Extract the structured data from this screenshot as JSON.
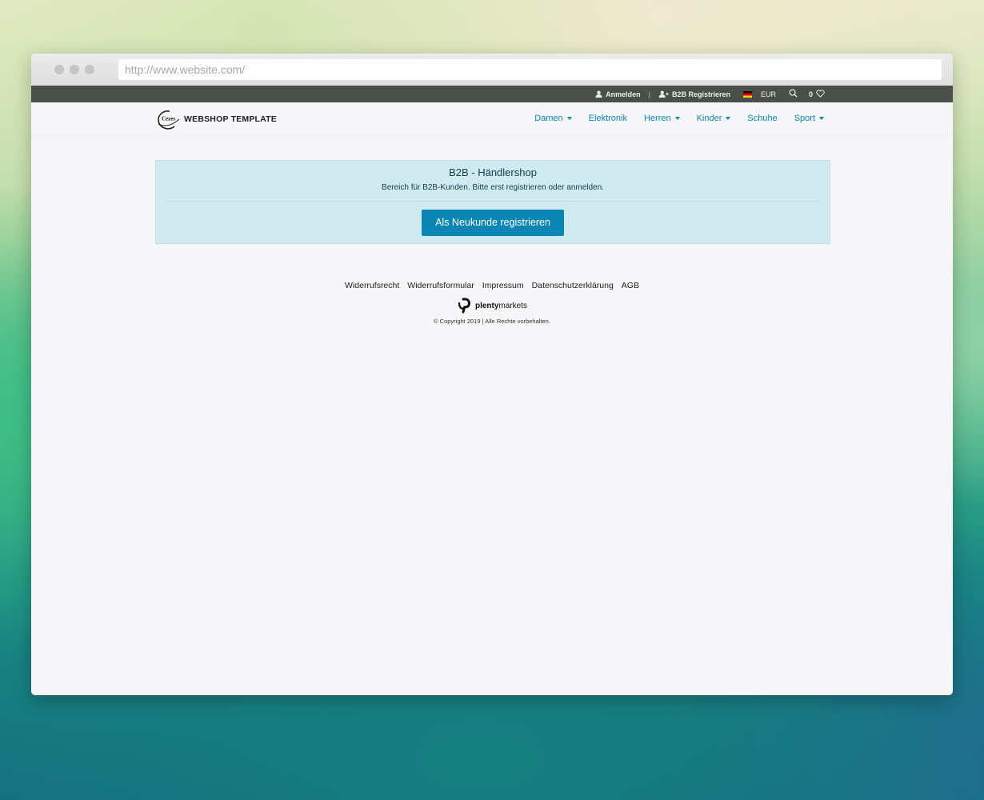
{
  "browser": {
    "url": "http://www.website.com/"
  },
  "topbar": {
    "login_label": "Anmelden",
    "separator": "|",
    "b2b_register_label": "B2B Registrieren",
    "currency": "EUR",
    "basket_count": "0"
  },
  "header": {
    "logo_mark_text": "Cezes",
    "logo_text": "WEBSHOP TEMPLATE",
    "nav": [
      {
        "label": "Damen"
      },
      {
        "label": "Elektronik"
      },
      {
        "label": "Herren"
      },
      {
        "label": "Kinder"
      },
      {
        "label": "Schuhe"
      },
      {
        "label": "Sport"
      }
    ]
  },
  "main": {
    "alert_title": "B2B - Händlershop",
    "alert_text": "Bereich für B2B-Kunden. Bitte erst registrieren oder anmelden.",
    "register_button": "Als Neukunde registrieren"
  },
  "footer": {
    "links": [
      "Widerrufsrecht",
      "Widerrufsformular",
      "Impressum",
      "Datenschutzerklärung",
      "AGB"
    ],
    "brand_bold": "plenty",
    "brand_light": "markets",
    "copyright": "© Copyright 2019 | Alle Rechte vorbehalten."
  },
  "colors": {
    "topbar_bg": "#4c4e4c",
    "link_blue": "#0b87b0",
    "alert_bg": "#d1eaef",
    "button_bg": "#0a86b4"
  }
}
